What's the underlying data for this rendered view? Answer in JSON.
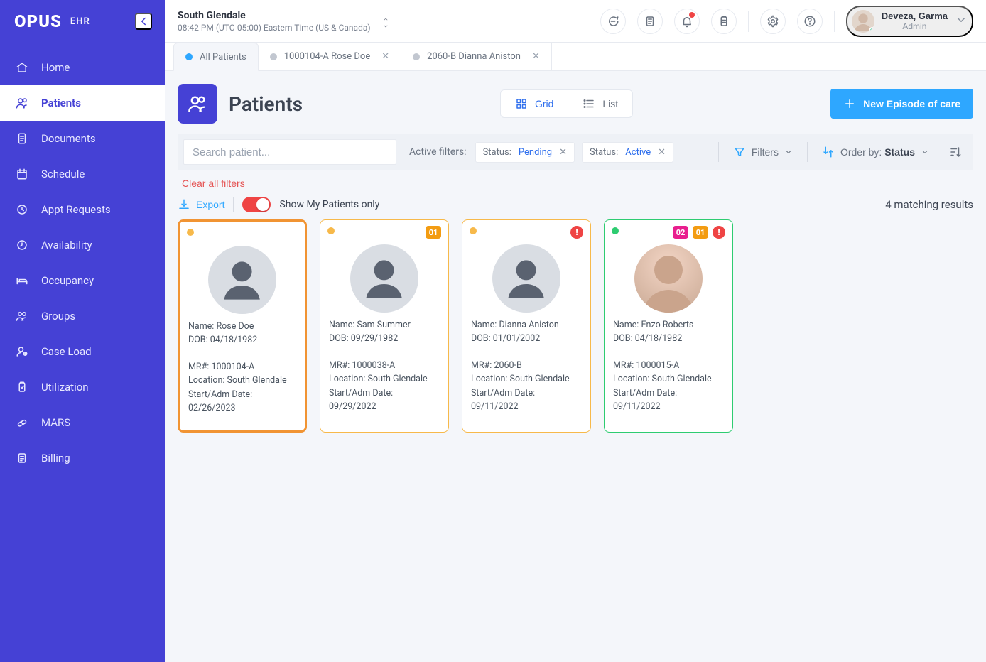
{
  "brand": {
    "name": "OPUS",
    "suffix": "EHR"
  },
  "sidebar": {
    "items": [
      {
        "label": "Home",
        "icon": "home"
      },
      {
        "label": "Patients",
        "icon": "patients",
        "active": true
      },
      {
        "label": "Documents",
        "icon": "documents"
      },
      {
        "label": "Schedule",
        "icon": "schedule"
      },
      {
        "label": "Appt Requests",
        "icon": "clock"
      },
      {
        "label": "Availability",
        "icon": "clock2"
      },
      {
        "label": "Occupancy",
        "icon": "bed"
      },
      {
        "label": "Groups",
        "icon": "groups"
      },
      {
        "label": "Case Load",
        "icon": "caseload"
      },
      {
        "label": "Utilization",
        "icon": "clipboard"
      },
      {
        "label": "MARS",
        "icon": "pill"
      },
      {
        "label": "Billing",
        "icon": "billing"
      }
    ]
  },
  "topbar": {
    "location": "South Glendale",
    "clock": "08:42 PM (UTC-05:00) Eastern Time (US & Canada)",
    "user": {
      "name": "Deveza, Garma",
      "role": "Admin"
    }
  },
  "tabs": [
    {
      "label": "All Patients",
      "active": true
    },
    {
      "label": "1000104-A Rose Doe",
      "closable": true
    },
    {
      "label": "2060-B Dianna Aniston",
      "closable": true
    }
  ],
  "page": {
    "title": "Patients",
    "view_grid": "Grid",
    "view_list": "List",
    "new_episode": "New Episode of care",
    "search_placeholder": "Search patient...",
    "active_filters_label": "Active filters:",
    "chips": [
      {
        "key": "Status:",
        "value": "Pending"
      },
      {
        "key": "Status:",
        "value": "Active"
      }
    ],
    "filters_label": "Filters",
    "order_prefix": "Order by:",
    "order_value": "Status",
    "clear_label": "Clear all filters",
    "export_label": "Export",
    "switch_label": "Show My Patients only",
    "results_label": "4 matching results"
  },
  "cards": [
    {
      "dot": "amber",
      "selected": true,
      "name": "Rose Doe",
      "dob": "04/18/1982",
      "mr": "1000104-A",
      "location": "South Glendale",
      "start": "02/26/2023"
    },
    {
      "dot": "amber",
      "badges": [
        {
          "type": "num",
          "color": "orange",
          "text": "01"
        }
      ],
      "name": "Sam Summer",
      "dob": "09/29/1982",
      "mr": "1000038-A",
      "location": "South Glendale",
      "start": "09/29/2022"
    },
    {
      "dot": "amber",
      "badges": [
        {
          "type": "bang"
        }
      ],
      "name": "Dianna Aniston",
      "dob": "01/01/2002",
      "mr": "2060-B",
      "location": "South Glendale",
      "start": "09/11/2022"
    },
    {
      "dot": "green",
      "photo": true,
      "badges": [
        {
          "type": "num",
          "color": "pink",
          "text": "02"
        },
        {
          "type": "num",
          "color": "orange",
          "text": "01"
        },
        {
          "type": "bang"
        }
      ],
      "name": "Enzo Roberts",
      "dob": "04/18/1982",
      "mr": "1000015-A",
      "location": "South Glendale",
      "start": "09/11/2022"
    }
  ],
  "labels": {
    "name": "Name:",
    "dob": "DOB:",
    "mr": "MR#:",
    "location": "Location:",
    "start": "Start/Adm Date:"
  }
}
